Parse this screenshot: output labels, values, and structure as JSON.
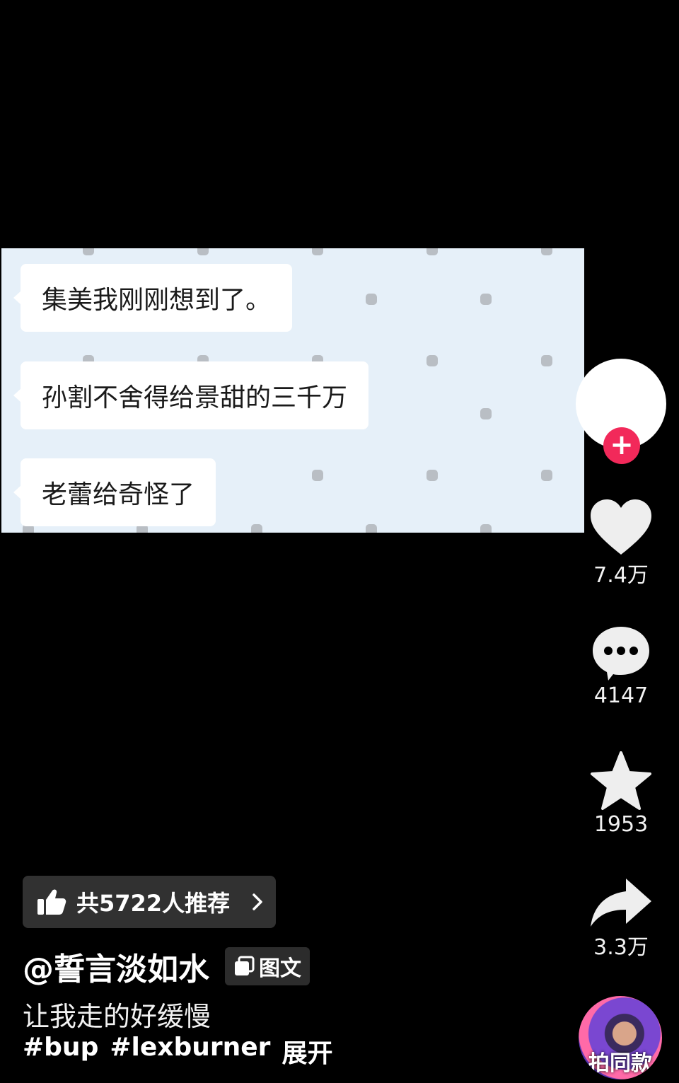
{
  "chat": {
    "messages": [
      "集美我刚刚想到了。",
      "孙割不舍得给景甜的三千万",
      "老蕾给奇怪了"
    ]
  },
  "rail": {
    "follow_icon": "plus-icon",
    "like": {
      "icon": "heart-icon",
      "count": "7.4万"
    },
    "comment": {
      "icon": "comment-icon",
      "count": "4147"
    },
    "favorite": {
      "icon": "star-icon",
      "count": "1953"
    },
    "share": {
      "icon": "share-icon",
      "count": "3.3万"
    },
    "music": {
      "label": "拍同款"
    }
  },
  "info": {
    "recommend_label": "共5722人推荐",
    "author": "@誓言淡如水",
    "type_badge": "图文",
    "caption": "让我走的好缓慢",
    "hashtags": [
      "#bup",
      "#lexburner"
    ],
    "expand": "展开"
  },
  "colors": {
    "accent": "#f2295a",
    "chat_bg": "#e6f0f9"
  }
}
